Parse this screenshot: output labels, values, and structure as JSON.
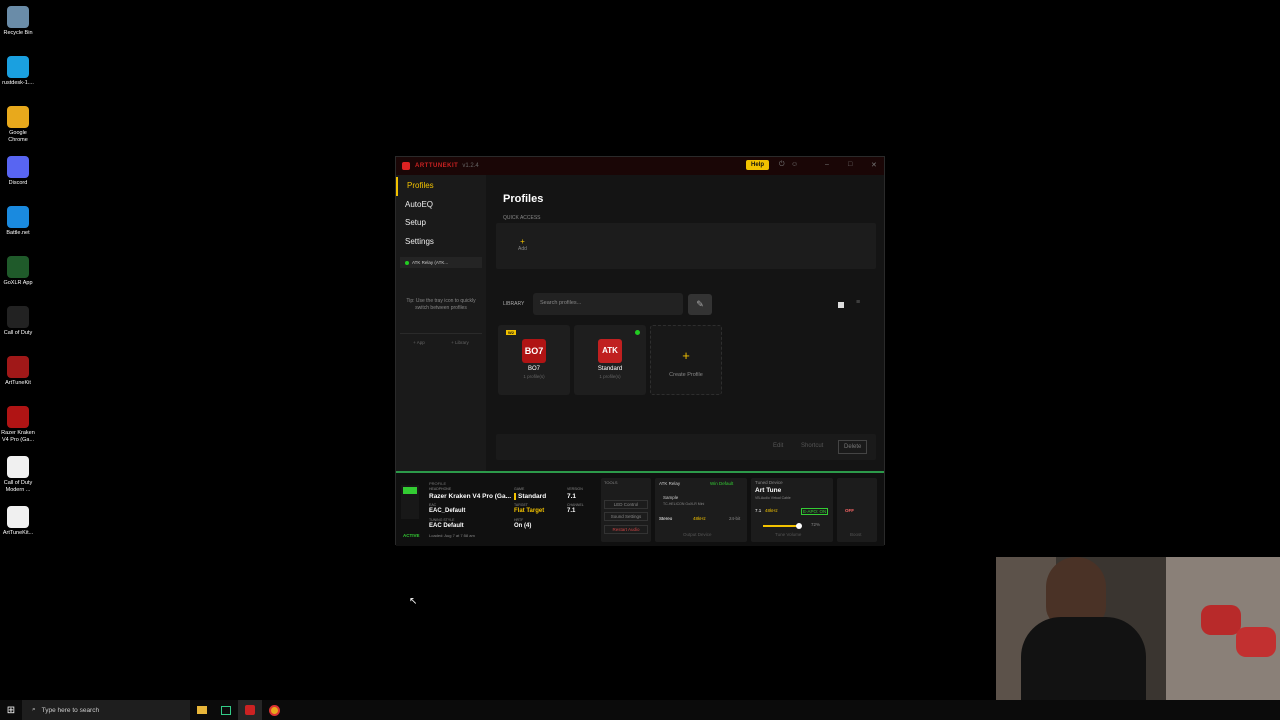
{
  "desktop": {
    "icons": [
      {
        "label": "Recycle Bin",
        "color": "#6a8ca8"
      },
      {
        "label": "rustdesk-1....",
        "color": "#1aa0e0"
      },
      {
        "label": "Google Chrome",
        "color": "#e8a91c"
      },
      {
        "label": "Discord",
        "color": "#5865f2"
      },
      {
        "label": "Battle.net",
        "color": "#1a8adf"
      },
      {
        "label": "GoXLR App",
        "color": "#1f5a2a"
      },
      {
        "label": "Call of Duty",
        "color": "#222"
      },
      {
        "label": "ArtTuneKit",
        "color": "#a01818"
      },
      {
        "label": "Razer Kraken V4 Pro (Ga...",
        "color": "#b01414"
      },
      {
        "label": "Call of Duty Modern ...",
        "color": "#f0f0f0"
      },
      {
        "label": "ArtTuneKit...",
        "color": "#f0f0f0"
      }
    ]
  },
  "window": {
    "app_name": "ARTTUNEKIT",
    "version": "v1.2.4",
    "help_label": "Help",
    "sidebar": {
      "items": [
        "Profiles",
        "AutoEQ",
        "Setup",
        "Settings"
      ],
      "relay_label": "ATK Relay (ATK...",
      "tip": "Tip: Use the tray icon to quickly switch between profiles",
      "bottom_buttons": [
        "+ App",
        "+ Library"
      ]
    },
    "main": {
      "title": "Profiles",
      "quick_access_label": "QUICK ACCESS",
      "quick_add_label": "Add",
      "library_label": "LIBRARY",
      "search_placeholder": "Search profiles...",
      "cards": [
        {
          "name": "BO7",
          "sub": "1 profile(s)",
          "badge": "W2",
          "thumb_text": "BO7",
          "color": "#b01414",
          "active": false
        },
        {
          "name": "Standard",
          "sub": "1 profile(s)",
          "badge": "",
          "thumb_text": "ATK",
          "color": "#c02020",
          "active": true
        }
      ],
      "create_label": "Create Profile",
      "actions": [
        "Edit",
        "Shortcut",
        "Delete"
      ]
    },
    "status": {
      "active_label": "ACTIVE",
      "profile_section": "PROFILE",
      "headphone_label": "HEADPHONE",
      "headphone": "Razer Kraken V4 Pro (Ga...",
      "game_label": "GAME",
      "game": "Standard",
      "version_label": "VERSION",
      "version": "7.1",
      "eac_label": "EAC",
      "eac": "EAC_Default",
      "target_label": "TARGET",
      "target": "Flat Target",
      "channel_label": "CHANNEL",
      "channel": "7.1",
      "tuning_label": "TUNING STYLE",
      "tuning": "EAC Default",
      "hrtf_label": "HRTF",
      "hrtf": "On (4)",
      "loaded": "Loaded: Aug 7 at 7:58 am",
      "tools_label": "TOOLS",
      "tools": [
        "LED Control",
        "Sound Settings",
        "Restart Audio"
      ],
      "relay_label": "ATK Relay",
      "win_default": "Win Default",
      "sample_label": "Sample",
      "sample_device": "TC-HELICON GoXLR Mini",
      "stereo": "Stereo",
      "rate": "48kHz",
      "bits": "24-bit",
      "output_label": "Output Device",
      "tuned_label": "Tuned Device",
      "tuned_name": "Art Tune",
      "tuned_sub": "VB-Audio Virtual Cable",
      "tuned_ch": "7.1",
      "tuned_rate": "48kHz",
      "tuned_apo": "E-APO: ON",
      "vol_pct": "72%",
      "vol_label": "Tune Volume",
      "off_label": "OFF",
      "boost_label": "Boost"
    }
  },
  "taskbar": {
    "search_placeholder": "Type here to search"
  }
}
